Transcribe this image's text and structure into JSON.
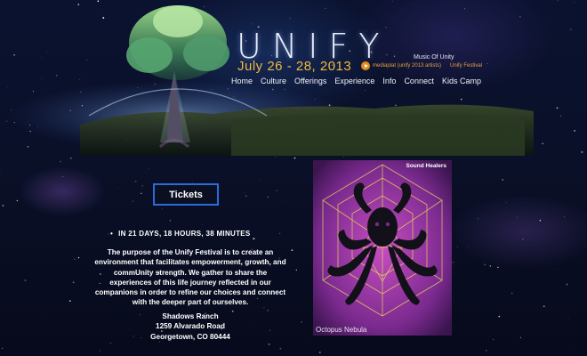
{
  "header": {
    "logo": "UNIFY",
    "dates": "July 26 - 28, 2013",
    "media_link": "mediaplat (unify 2013 artists)",
    "music_title": "Music Of Unity",
    "music_subtitle": "Unify Festival"
  },
  "nav": [
    "Home",
    "Culture",
    "Offerings",
    "Experience",
    "Info",
    "Connect",
    "Kids Camp"
  ],
  "tickets_label": "Tickets",
  "countdown": "IN 21 DAYS, 18 HOURS, 38 MINUTES",
  "purpose": "The purpose of the Unify Festival is to create an environment that facilitates empowerment, growth, and commUnity strength. We gather to share the experiences of this life journey reflected in our companions in order to refine our choices and connect with the deeper part of ourselves.",
  "address": {
    "venue": "Shadows Ranch",
    "street": "1259 Alvarado Road",
    "city": "Georgetown, CO 80444"
  },
  "album": {
    "artist": "Sound Healers",
    "title": "Octopus Nebula"
  },
  "colors": {
    "accent_orange": "#f0b840",
    "link_orange": "#e8a040",
    "tickets_border": "#2b6bd9",
    "album_purple": "#7a2a8e"
  }
}
